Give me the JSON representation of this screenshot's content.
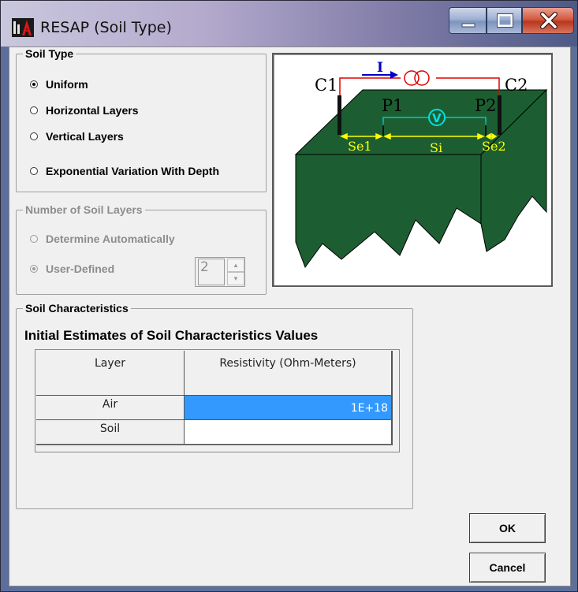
{
  "window": {
    "title": "RESAP (Soil Type)",
    "controls": [
      "minimize-icon",
      "maximize-icon",
      "close-icon"
    ]
  },
  "soil_type": {
    "label": "Soil Type",
    "mnemonic": "y",
    "options": [
      {
        "label": "Uniform",
        "checked": true
      },
      {
        "label": "Horizontal Layers",
        "checked": false
      },
      {
        "label": "Vertical Layers",
        "checked": false
      },
      {
        "label": "Exponential Variation With Depth",
        "checked": false
      }
    ]
  },
  "num_layers": {
    "label": "Number of Soil Layers",
    "mnemonic": "L",
    "enabled": false,
    "options": [
      {
        "label": "Determine Automatically",
        "checked": false
      },
      {
        "label": "User-Defined",
        "checked": true
      }
    ],
    "spinner_value": "2"
  },
  "diagram": {
    "labels": {
      "c1": "C1",
      "c2": "C2",
      "p1": "P1",
      "p2": "P2",
      "current": "I",
      "voltmeter": "V",
      "se1": "Se1",
      "si": "Si",
      "se2": "Se2"
    },
    "colors": {
      "soil": "#1c5e32",
      "wire_current": "#e00000",
      "wire_potential": "#00c8c8",
      "spacing": "#ffff00",
      "arrow": "#0000c8"
    }
  },
  "soil_characteristics": {
    "label": "Soil Characteristics",
    "mnemonic": "h",
    "heading": "Initial Estimates of Soil Characteristics Values",
    "columns": [
      "Layer",
      "Resistivity (Ohm-Meters)"
    ],
    "rows": [
      {
        "layer": "Air",
        "resistivity": "1E+18",
        "selected": true
      },
      {
        "layer": "Soil",
        "resistivity": "",
        "selected": false
      }
    ]
  },
  "buttons": {
    "ok": "OK",
    "cancel": "Cancel"
  },
  "colors": {
    "selection": "#3399ff",
    "dialog_bg": "#f0f0f0",
    "close_button": "#c8432b"
  }
}
